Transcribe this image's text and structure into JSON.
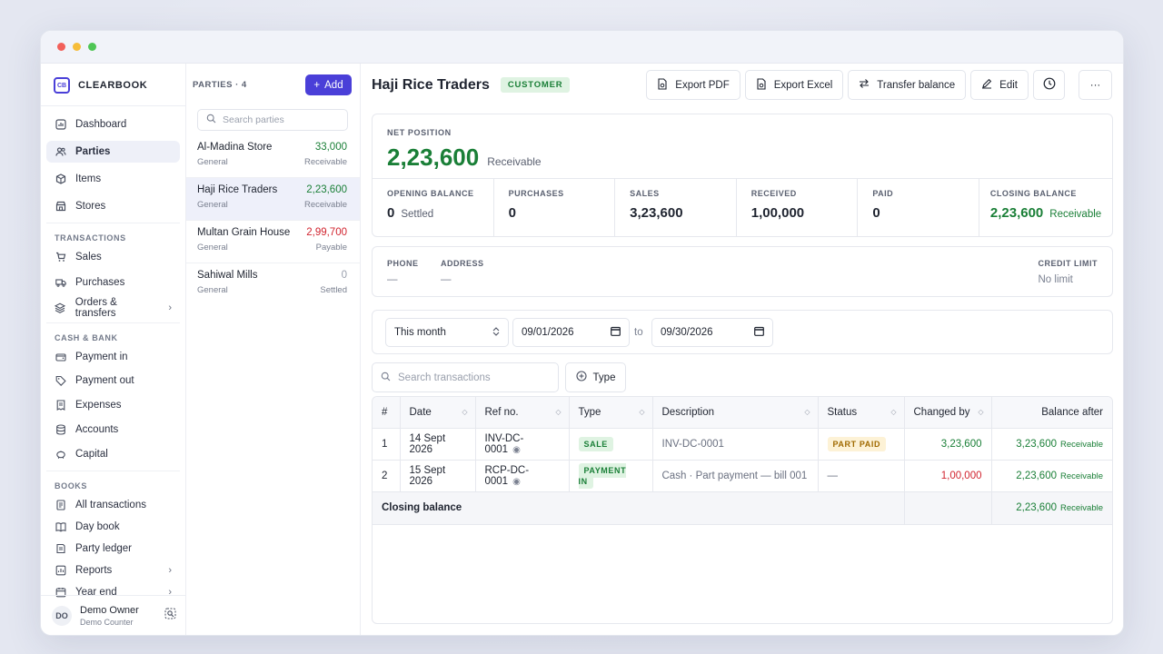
{
  "brand": {
    "logo": "CB",
    "name": "CLEARBOOK"
  },
  "nav": {
    "main": [
      {
        "label": "Dashboard",
        "icon": "dashboard-icon"
      },
      {
        "label": "Parties",
        "icon": "users-icon"
      },
      {
        "label": "Items",
        "icon": "box-icon"
      },
      {
        "label": "Stores",
        "icon": "store-icon"
      }
    ],
    "transactions_label": "TRANSACTIONS",
    "transactions": [
      {
        "label": "Sales"
      },
      {
        "label": "Purchases"
      },
      {
        "label": "Orders & transfers"
      }
    ],
    "cash_label": "CASH & BANK",
    "cash": [
      {
        "label": "Payment in"
      },
      {
        "label": "Payment out"
      },
      {
        "label": "Expenses"
      },
      {
        "label": "Accounts"
      },
      {
        "label": "Capital"
      }
    ],
    "books_label": "BOOKS",
    "books": [
      {
        "label": "All transactions"
      },
      {
        "label": "Day book"
      },
      {
        "label": "Party ledger"
      },
      {
        "label": "Reports"
      },
      {
        "label": "Year end"
      }
    ]
  },
  "user": {
    "initials": "DO",
    "name": "Demo Owner",
    "sub": "Demo Counter"
  },
  "parties": {
    "title": "PARTIES · 4",
    "add_label": "Add",
    "search_placeholder": "Search parties",
    "items": [
      {
        "name": "Al-Madina Store",
        "amount": "33,000",
        "group": "General",
        "status": "Receivable",
        "tone": "green"
      },
      {
        "name": "Haji Rice Traders",
        "amount": "2,23,600",
        "group": "General",
        "status": "Receivable",
        "tone": "green"
      },
      {
        "name": "Multan Grain House",
        "amount": "2,99,700",
        "group": "General",
        "status": "Payable",
        "tone": "red"
      },
      {
        "name": "Sahiwal Mills",
        "amount": "0",
        "group": "General",
        "status": "Settled",
        "tone": "muted"
      }
    ]
  },
  "header": {
    "title": "Haji Rice Traders",
    "badge": "CUSTOMER",
    "actions": {
      "export_pdf": "Export PDF",
      "export_excel": "Export Excel",
      "transfer": "Transfer balance",
      "edit": "Edit"
    }
  },
  "net": {
    "label": "NET POSITION",
    "value": "2,23,600",
    "note": "Receivable"
  },
  "stats": [
    {
      "label": "OPENING BALANCE",
      "value": "0",
      "note": "Settled"
    },
    {
      "label": "PURCHASES",
      "value": "0",
      "note": ""
    },
    {
      "label": "SALES",
      "value": "3,23,600",
      "note": ""
    },
    {
      "label": "RECEIVED",
      "value": "1,00,000",
      "note": ""
    },
    {
      "label": "PAID",
      "value": "0",
      "note": ""
    },
    {
      "label": "CLOSING BALANCE",
      "value": "2,23,600",
      "note": "Receivable"
    }
  ],
  "info": {
    "phone_label": "PHONE",
    "phone": "—",
    "address_label": "ADDRESS",
    "address": "—",
    "credit_label": "CREDIT LIMIT",
    "credit": "No limit"
  },
  "filters": {
    "period": "This month",
    "from": "09/01/2026",
    "to_label": "to",
    "to": "09/30/2026",
    "search_placeholder": "Search transactions",
    "type_label": "Type"
  },
  "table": {
    "columns": [
      "#",
      "Date",
      "Ref no.",
      "Type",
      "Description",
      "Status",
      "Changed by",
      "Balance after"
    ],
    "rows": [
      {
        "n": "1",
        "date": "14 Sept 2026",
        "ref": "INV-DC-0001",
        "type": "SALE",
        "desc": "INV-DC-0001",
        "status": "PART PAID",
        "changed": "3,23,600",
        "balance": "3,23,600",
        "balance_note": "Receivable"
      },
      {
        "n": "2",
        "date": "15 Sept 2026",
        "ref": "RCP-DC-0001",
        "type": "PAYMENT IN",
        "desc": "Cash · Part payment — bill 001",
        "status": "—",
        "changed": "1,00,000",
        "balance": "2,23,600",
        "balance_note": "Receivable"
      }
    ],
    "closing_label": "Closing balance",
    "closing_value": "2,23,600",
    "closing_note": "Receivable"
  },
  "colors": {
    "accent": "#4a3fd8",
    "positive": "#1a7f37",
    "negative": "#d1242f"
  }
}
